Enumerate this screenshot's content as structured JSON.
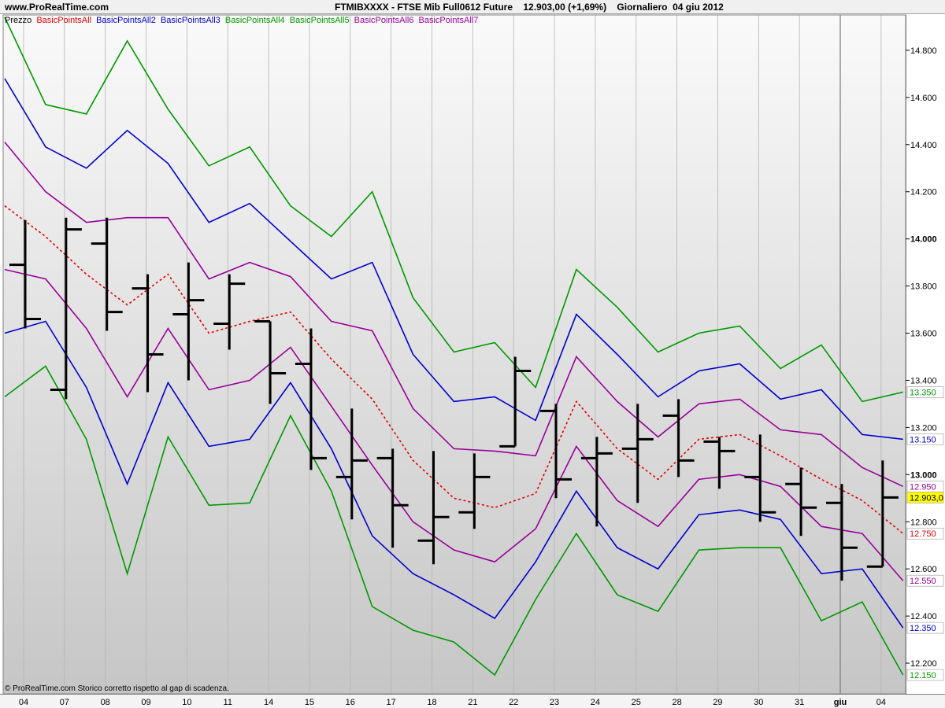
{
  "header": {
    "site": "www.ProRealTime.com",
    "title": "FTMIBXXXX - FTSE Mib Full0612 Future    12.903,00 (+1,69%)    Giornaliero  04 giu 2012"
  },
  "legend": {
    "items": [
      {
        "text": "Prezzo",
        "color": "#000000"
      },
      {
        "text": "BasicPointsAll",
        "color": "#e00000"
      },
      {
        "text": "BasicPointsAll2",
        "color": "#0000cc"
      },
      {
        "text": "BasicPointsAll3",
        "color": "#0000cc"
      },
      {
        "text": "BasicPointsAll4",
        "color": "#009900"
      },
      {
        "text": "BasicPointsAll5",
        "color": "#009900"
      },
      {
        "text": "BasicPointsAll6",
        "color": "#990099"
      },
      {
        "text": "BasicPointsAll7",
        "color": "#990099"
      }
    ]
  },
  "footer": {
    "note": "© ProRealTime.com  Storico corretto rispetto al gap di scadenza."
  },
  "chart_data": {
    "type": "ohlc",
    "x_labels": [
      "04",
      "07",
      "08",
      "09",
      "10",
      "11",
      "14",
      "15",
      "16",
      "17",
      "18",
      "21",
      "22",
      "23",
      "24",
      "25",
      "28",
      "29",
      "30",
      "31",
      "giu",
      "04"
    ],
    "ylim": [
      12070,
      14950
    ],
    "y_ticks": [
      {
        "v": 12200,
        "label": "12.200"
      },
      {
        "v": 12400,
        "label": "12.400"
      },
      {
        "v": 12600,
        "label": "12.600"
      },
      {
        "v": 12800,
        "label": "12.800"
      },
      {
        "v": 13000,
        "label": "13.000"
      },
      {
        "v": 13200,
        "label": "13.200"
      },
      {
        "v": 13400,
        "label": "13.400"
      },
      {
        "v": 13600,
        "label": "13.600"
      },
      {
        "v": 13800,
        "label": "13.800"
      },
      {
        "v": 14000,
        "label": "14.000"
      },
      {
        "v": 14200,
        "label": "14.200"
      },
      {
        "v": 14400,
        "label": "14.400"
      },
      {
        "v": 14600,
        "label": "14.600"
      },
      {
        "v": 14800,
        "label": "14.800"
      }
    ],
    "bold_ticks": [
      "13.000",
      "14.000"
    ],
    "grid": "vertical",
    "month_divider_index": 20,
    "ohlc": [
      {
        "o": 13890,
        "h": 14080,
        "l": 13620,
        "c": 13660
      },
      {
        "o": 13360,
        "h": 14090,
        "l": 13320,
        "c": 14040
      },
      {
        "o": 13980,
        "h": 14090,
        "l": 13610,
        "c": 13690
      },
      {
        "o": 13790,
        "h": 13850,
        "l": 13350,
        "c": 13510
      },
      {
        "o": 13680,
        "h": 13900,
        "l": 13400,
        "c": 13740
      },
      {
        "o": 13640,
        "h": 13850,
        "l": 13530,
        "c": 13810
      },
      {
        "o": 13650,
        "h": 13650,
        "l": 13300,
        "c": 13430
      },
      {
        "o": 13470,
        "h": 13620,
        "l": 13020,
        "c": 13070
      },
      {
        "o": 12990,
        "h": 13280,
        "l": 12810,
        "c": 13060
      },
      {
        "o": 13070,
        "h": 13110,
        "l": 12690,
        "c": 12870
      },
      {
        "o": 12720,
        "h": 13100,
        "l": 12620,
        "c": 12820
      },
      {
        "o": 12840,
        "h": 13090,
        "l": 12770,
        "c": 12990
      },
      {
        "o": 13120,
        "h": 13500,
        "l": 13120,
        "c": 13440
      },
      {
        "o": 13270,
        "h": 13300,
        "l": 12900,
        "c": 12980
      },
      {
        "o": 13070,
        "h": 13160,
        "l": 12780,
        "c": 13090
      },
      {
        "o": 13110,
        "h": 13300,
        "l": 12880,
        "c": 13150
      },
      {
        "o": 13250,
        "h": 13320,
        "l": 12990,
        "c": 13060
      },
      {
        "o": 13140,
        "h": 13160,
        "l": 12940,
        "c": 13100
      },
      {
        "o": 12990,
        "h": 13170,
        "l": 12800,
        "c": 12840
      },
      {
        "o": 12960,
        "h": 13030,
        "l": 12740,
        "c": 12860
      },
      {
        "o": 12880,
        "h": 12960,
        "l": 12550,
        "c": 12690
      },
      {
        "o": 12610,
        "h": 13060,
        "l": 12610,
        "c": 12903
      }
    ],
    "series": [
      {
        "name": "BasicPointsAll",
        "color": "#e00000",
        "dashed": true,
        "values": [
          14140,
          14010,
          13850,
          13720,
          13850,
          13600,
          13650,
          13690,
          13490,
          13320,
          13060,
          12900,
          12860,
          12920,
          13310,
          13110,
          12980,
          13150,
          13170,
          13080,
          12980,
          12890,
          12750
        ]
      },
      {
        "name": "BasicPointsAll2",
        "color": "#0000cc",
        "values": [
          14680,
          14390,
          14300,
          14460,
          14320,
          14070,
          14150,
          13990,
          13830,
          13900,
          13510,
          13310,
          13330,
          13230,
          13680,
          13510,
          13330,
          13440,
          13470,
          13320,
          13360,
          13170,
          13150
        ]
      },
      {
        "name": "BasicPointsAll3",
        "color": "#0000cc",
        "values": [
          13600,
          13650,
          13370,
          12960,
          13390,
          13120,
          13150,
          13390,
          13110,
          12740,
          12580,
          12490,
          12390,
          12630,
          12930,
          12690,
          12600,
          12830,
          12850,
          12810,
          12580,
          12600,
          12350
        ]
      },
      {
        "name": "BasicPointsAll4",
        "color": "#009900",
        "values": [
          14940,
          14570,
          14530,
          14840,
          14550,
          14310,
          14390,
          14140,
          14010,
          14200,
          13750,
          13520,
          13560,
          13370,
          13870,
          13710,
          13520,
          13600,
          13630,
          13450,
          13550,
          13310,
          13350
        ]
      },
      {
        "name": "BasicPointsAll5",
        "color": "#009900",
        "values": [
          13330,
          13460,
          13150,
          12580,
          13160,
          12870,
          12880,
          13250,
          12930,
          12440,
          12340,
          12290,
          12150,
          12470,
          12750,
          12490,
          12420,
          12680,
          12690,
          12690,
          12380,
          12460,
          12150
        ]
      },
      {
        "name": "BasicPointsAll6",
        "color": "#990099",
        "values": [
          14410,
          14200,
          14070,
          14090,
          14090,
          13830,
          13900,
          13840,
          13650,
          13610,
          13280,
          13110,
          13100,
          13080,
          13500,
          13310,
          13160,
          13300,
          13320,
          13190,
          13170,
          13030,
          12950
        ]
      },
      {
        "name": "BasicPointsAll7",
        "color": "#990099",
        "values": [
          13870,
          13830,
          13620,
          13330,
          13620,
          13360,
          13400,
          13540,
          13290,
          13040,
          12800,
          12680,
          12630,
          12770,
          13120,
          12890,
          12780,
          12980,
          13000,
          12950,
          12780,
          12750,
          12550
        ]
      }
    ],
    "right_labels": [
      {
        "text": "13.350",
        "color": "#009900",
        "bg": "#ffffff"
      },
      {
        "text": "13.150",
        "color": "#0000cc",
        "bg": "#ffffff"
      },
      {
        "text": "12.950",
        "color": "#990099",
        "bg": "#ffffff"
      },
      {
        "text": "12.903,0",
        "color": "#000000",
        "bg": "#ffff00"
      },
      {
        "text": "12.750",
        "color": "#e00000",
        "bg": "#ffffff"
      },
      {
        "text": "12.550",
        "color": "#990099",
        "bg": "#ffffff"
      },
      {
        "text": "12.350",
        "color": "#0000cc",
        "bg": "#ffffff"
      },
      {
        "text": "12.150",
        "color": "#009900",
        "bg": "#ffffff"
      }
    ],
    "right_label_values": [
      13350,
      13150,
      12950,
      12903,
      12750,
      12550,
      12350,
      12150
    ]
  }
}
